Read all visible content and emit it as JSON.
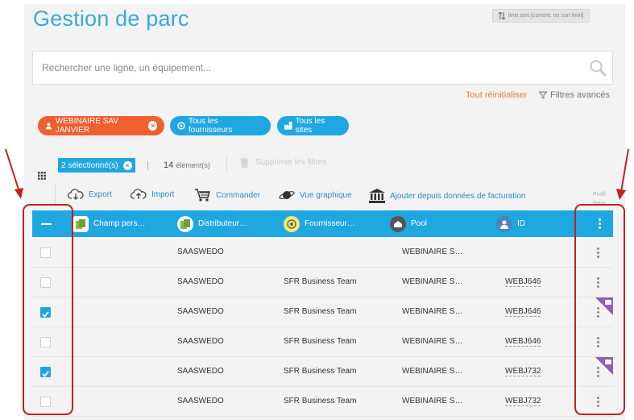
{
  "page": {
    "title": "Gestion de parc",
    "limit_sort": "limit sort [current: no sort limit]"
  },
  "search": {
    "placeholder": "Rechercher une ligne, un équipement..."
  },
  "filters_bar": {
    "reset_label": "Tout réinitialiser",
    "advanced_label": "Filtres avancés"
  },
  "chips": [
    {
      "label": "WEBINAIRE SAV JANVIER",
      "color": "#f05f2e"
    },
    {
      "label": "Tous les fournisseurs",
      "color": "#1fa7e1"
    },
    {
      "label": "Tous les sites",
      "color": "#1fa7e1"
    }
  ],
  "selection": {
    "selected_label": "2 sélectionné(s)",
    "separator": "|",
    "count": "14",
    "count_unit": "élément(s)",
    "delete_label": "Supprimer les filtres"
  },
  "toolbar": {
    "export": "Export",
    "import": "Import",
    "order": "Commander",
    "graph_view": "Vue graphique",
    "add_billing": "Ajouter depuis données de facturation",
    "profile_label": "Profil temp"
  },
  "table": {
    "columns": [
      "Champ pers…",
      "Distributeur…",
      "Fournisseur…",
      "Pool",
      "ID"
    ],
    "rows": [
      {
        "checked": false,
        "champ": "",
        "distributeur": "SAASWEDO",
        "fournisseur": "",
        "pool": "WEBINAIRE S…",
        "id": "",
        "flag": false
      },
      {
        "checked": false,
        "champ": "",
        "distributeur": "SAASWEDO",
        "fournisseur": "SFR Business Team",
        "pool": "WEBINAIRE S…",
        "id": "WEBJ646",
        "flag": false
      },
      {
        "checked": true,
        "champ": "",
        "distributeur": "SAASWEDO",
        "fournisseur": "SFR Business Team",
        "pool": "WEBINAIRE S…",
        "id": "WEBJ646",
        "flag": true
      },
      {
        "checked": false,
        "champ": "",
        "distributeur": "SAASWEDO",
        "fournisseur": "SFR Business Team",
        "pool": "WEBINAIRE S…",
        "id": "WEBJ646",
        "flag": false
      },
      {
        "checked": true,
        "champ": "",
        "distributeur": "SAASWEDO",
        "fournisseur": "SFR Business Team",
        "pool": "WEBINAIRE S…",
        "id": "WEBJ732",
        "flag": true
      },
      {
        "checked": false,
        "champ": "",
        "distributeur": "SAASWEDO",
        "fournisseur": "SFR Business Team",
        "pool": "WEBINAIRE S…",
        "id": "WEBJ732",
        "flag": false
      }
    ]
  },
  "colors": {
    "accent": "#1fa7e1",
    "orange": "#f05f2e",
    "highlight": "#c4201d",
    "flag": "#8e5fb5"
  }
}
